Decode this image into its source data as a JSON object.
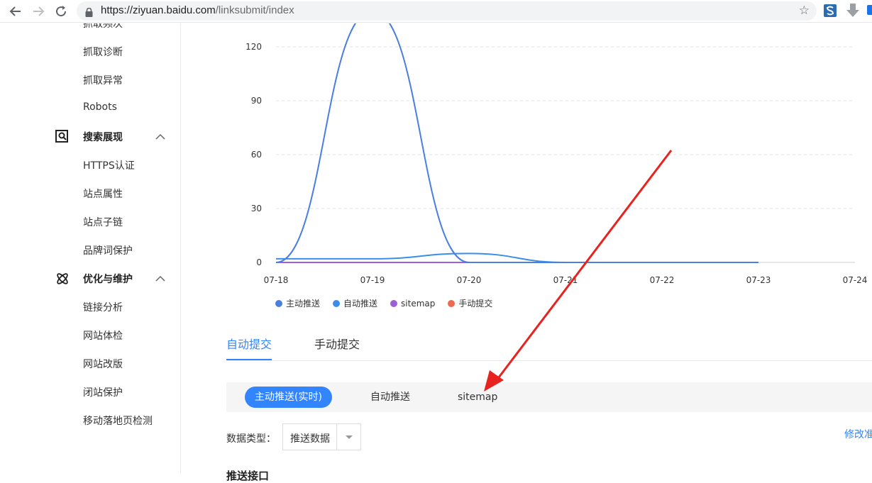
{
  "browser": {
    "url_host": "https://ziyuan.baidu.com",
    "url_path": "/linksubmit/index"
  },
  "sidebar": {
    "top_cut_label": "抓取频次",
    "items_a": [
      {
        "label": "抓取诊断"
      },
      {
        "label": "抓取异常"
      },
      {
        "label": "Robots"
      }
    ],
    "group_search": {
      "label": "搜索展现"
    },
    "items_b": [
      {
        "label": "HTTPS认证"
      },
      {
        "label": "站点属性"
      },
      {
        "label": "站点子链"
      },
      {
        "label": "品牌词保护"
      }
    ],
    "group_optimize": {
      "label": "优化与维护"
    },
    "items_c": [
      {
        "label": "链接分析"
      },
      {
        "label": "网站体检"
      },
      {
        "label": "网站改版"
      },
      {
        "label": "闭站保护"
      },
      {
        "label": "移动落地页检测"
      }
    ]
  },
  "chart_data": {
    "type": "line",
    "x": [
      "07-18",
      "07-19",
      "07-20",
      "07-21",
      "07-22",
      "07-23",
      "07-24"
    ],
    "yticks": [
      0,
      30,
      60,
      90,
      120
    ],
    "ylim": [
      0,
      130
    ],
    "grid": true,
    "legend_position": "bottom-left",
    "series": [
      {
        "name": "主动推送",
        "color": "#4a7fe0",
        "values": [
          0,
          140,
          0,
          0,
          0,
          0,
          null
        ]
      },
      {
        "name": "自动推送",
        "color": "#3a8ee6",
        "values": [
          2,
          2,
          5,
          0,
          0,
          0,
          null
        ]
      },
      {
        "name": "sitemap",
        "color": "#9b5fd6",
        "values": [
          0,
          0,
          0,
          0,
          0,
          0,
          null
        ]
      },
      {
        "name": "手动提交",
        "color": "#ee6a50",
        "values": [
          0,
          0,
          0,
          0,
          0,
          0,
          null
        ]
      }
    ]
  },
  "tabs": [
    {
      "label": "自动提交",
      "active": true
    },
    {
      "label": "手动提交",
      "active": false
    }
  ],
  "subtabs": [
    {
      "label": "主动推送(实时)",
      "active": true
    },
    {
      "label": "自动推送",
      "active": false
    },
    {
      "label": "sitemap",
      "active": false
    }
  ],
  "filter": {
    "label": "数据类型：",
    "selected": "推送数据"
  },
  "modify_link": "修改准",
  "section_heading_cut": "推送接口"
}
